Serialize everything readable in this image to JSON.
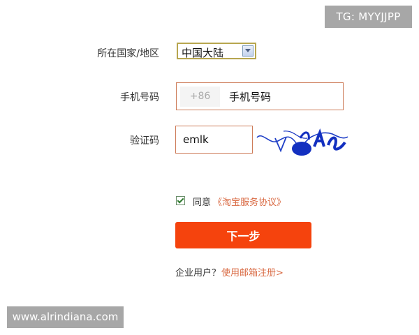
{
  "watermark_top": "TG: MYYJJPP",
  "watermark_bottom": "www.alrindiana.com",
  "region": {
    "label": "所在国家/地区",
    "selected": "中国大陆"
  },
  "phone": {
    "label": "手机号码",
    "prefix": "+86",
    "value": "手机号码"
  },
  "captcha": {
    "label": "验证码",
    "value": "emlk"
  },
  "agreement": {
    "checked": true,
    "text": "同意",
    "link": "《淘宝服务协议》"
  },
  "next_button": "下一步",
  "enterprise": {
    "text": "企业用户？",
    "link": "使用邮箱注册>"
  },
  "colors": {
    "primary_button": "#f5430d",
    "link": "#d96a43",
    "input_border": "#cd7b58",
    "watermark_bg": "#a7a7a7"
  }
}
